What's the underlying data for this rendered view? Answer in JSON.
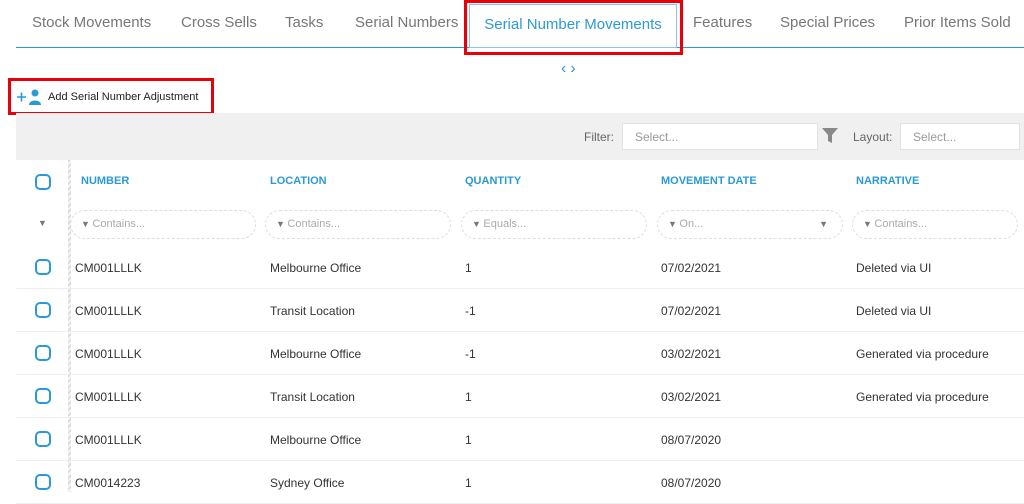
{
  "tabs": [
    {
      "label": "Stock Movements"
    },
    {
      "label": "Cross Sells"
    },
    {
      "label": "Tasks"
    },
    {
      "label": "Serial Numbers"
    },
    {
      "label": "Serial Number Movements",
      "active": true
    },
    {
      "label": "Features"
    },
    {
      "label": "Special Prices"
    },
    {
      "label": "Prior Items Sold"
    }
  ],
  "nav": {
    "prev": "‹",
    "next": "›"
  },
  "add_button": {
    "label": "Add Serial Number Adjustment",
    "icon": "add-user-icon"
  },
  "toolbar": {
    "filter_label": "Filter:",
    "filter_placeholder": "Select...",
    "layout_label": "Layout:",
    "layout_placeholder": "Select..."
  },
  "columns": [
    {
      "header": "NUMBER",
      "filter": "Contains..."
    },
    {
      "header": "LOCATION",
      "filter": "Contains..."
    },
    {
      "header": "QUANTITY",
      "filter": "Equals..."
    },
    {
      "header": "MOVEMENT DATE",
      "filter": "On..."
    },
    {
      "header": "NARRATIVE",
      "filter": "Contains..."
    }
  ],
  "rows": [
    [
      "CM001LLLK",
      "Melbourne Office",
      "1",
      "07/02/2021",
      "Deleted via UI"
    ],
    [
      "CM001LLLK",
      "Transit Location",
      "-1",
      "07/02/2021",
      "Deleted via UI"
    ],
    [
      "CM001LLLK",
      "Melbourne Office",
      "-1",
      "03/02/2021",
      "Generated via procedure"
    ],
    [
      "CM001LLLK",
      "Transit Location",
      "1",
      "03/02/2021",
      "Generated via procedure"
    ],
    [
      "CM001LLLK",
      "Melbourne Office",
      "1",
      "08/07/2020",
      ""
    ],
    [
      "CM0014223",
      "Sydney Office",
      "1",
      "08/07/2020",
      ""
    ]
  ],
  "colors": {
    "accent": "#2a9ad6",
    "highlight": "#e8000b"
  }
}
